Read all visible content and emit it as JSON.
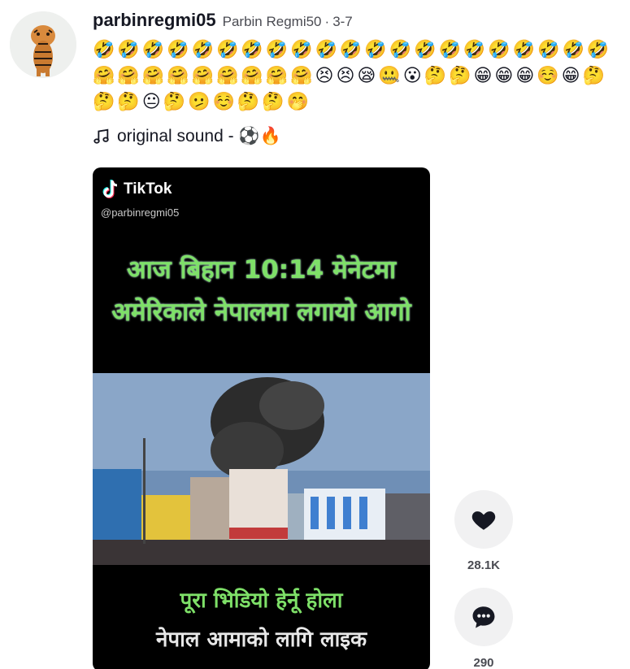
{
  "post": {
    "username": "parbinregmi05",
    "nickname": "Parbin Regmi50",
    "separator": "·",
    "date": "3-7",
    "caption": "🤣🤣🤣🤣🤣🤣🤣🤣🤣🤣🤣🤣🤣🤣🤣🤣🤣🤣🤣🤣🤣🤗🤗🤗🤗🤗🤗🤗🤗🤗😣😣😪🤐😮🤔🤔😁😁😁☺️😁🤔🤔🤔😐🤔🫤☺️🤔🤔🤭",
    "music": "original sound - ⚽🔥"
  },
  "video": {
    "brand": "TikTok",
    "handle": "@parbinregmi05",
    "headline": "आज बिहान 10:14 मेनेटमा अमेरिकाले नेपालमा लगायो आगो",
    "bottom_line1": "पूरा भिडियो हेर्नू होला",
    "bottom_line2": "नेपाल आमाको लागि लाइक"
  },
  "actions": {
    "like_count": "28.1K",
    "comment_count": "290"
  },
  "icons": {
    "avatar": "tiger-avatar",
    "music": "music-note-icon",
    "like": "heart-icon",
    "comment": "comment-bubble-icon",
    "brand": "tiktok-logo-icon"
  },
  "colors": {
    "text": "#161823",
    "muted": "#4a4b52",
    "action_bg": "#f1f1f2",
    "overlay_green": "#7ee068"
  }
}
